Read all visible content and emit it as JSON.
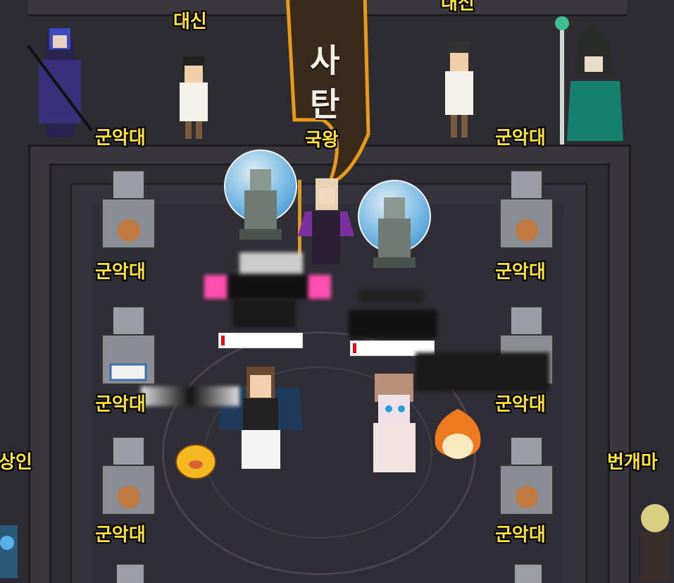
{
  "labels": {
    "minister_left": "대신",
    "minister_right": "대신",
    "king": "국왕",
    "band": "군악대",
    "merchant": "상인",
    "lightning_mage": "번개마"
  },
  "banner": {
    "char1": "사",
    "char2": "탄"
  },
  "colors": {
    "label": "#ffe23a",
    "banner": "#3a2a1c",
    "banner_border": "#e89a1a",
    "hp": "#e01010"
  }
}
